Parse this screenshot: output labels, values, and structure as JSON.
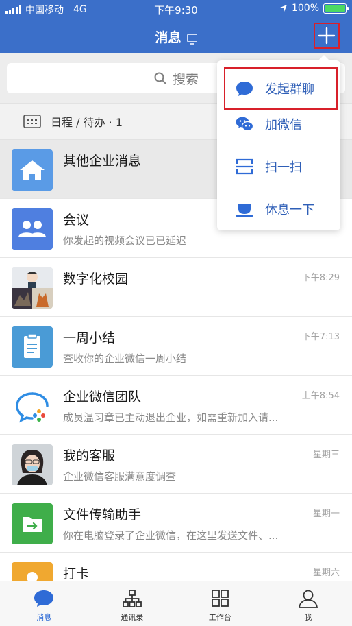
{
  "status_bar": {
    "carrier": "中国移动",
    "network": "4G",
    "time": "下午9:30",
    "battery": "100%"
  },
  "header": {
    "title": "消息"
  },
  "search": {
    "placeholder": "搜索"
  },
  "agenda": {
    "label": "日程 / 待办 · 1"
  },
  "popup_menu": {
    "items": [
      {
        "label": "发起群聊",
        "icon": "chat-bubble-icon"
      },
      {
        "label": "加微信",
        "icon": "wechat-icon"
      },
      {
        "label": "扫一扫",
        "icon": "scan-icon"
      },
      {
        "label": "休息一下",
        "icon": "rest-icon"
      }
    ]
  },
  "conversations": [
    {
      "title": "其他企业消息",
      "subtitle": "",
      "time": "",
      "icon": "building-icon",
      "color": "#5a9be6"
    },
    {
      "title": "会议",
      "subtitle": "你发起的视频会议已已延迟",
      "time": "",
      "icon": "meeting-icon",
      "color": "#4f7fe0"
    },
    {
      "title": "数字化校园",
      "subtitle": "",
      "time": "下午8:29",
      "icon": "group-photo-avatar",
      "color": "#bfbfbf"
    },
    {
      "title": "一周小结",
      "subtitle": "查收你的企业微信一周小结",
      "time": "下午7:13",
      "icon": "clipboard-icon",
      "color": "#4a9bd6"
    },
    {
      "title": "企业微信团队",
      "subtitle": "成员温习章已主动退出企业，如需重新加入请...",
      "time": "上午8:54",
      "icon": "wecom-logo-icon",
      "color": "#ffffff"
    },
    {
      "title": "我的客服",
      "subtitle": "企业微信客服满意度调查",
      "time": "星期三",
      "icon": "agent-photo-avatar",
      "color": "#c9c9c9"
    },
    {
      "title": "文件传输助手",
      "subtitle": "你在电脑登录了企业微信，在这里发送文件、...",
      "time": "星期一",
      "icon": "folder-icon",
      "color": "#3fae4a"
    },
    {
      "title": "打卡",
      "subtitle": "",
      "time": "星期六",
      "icon": "clock-in-icon",
      "color": "#f0a830"
    }
  ],
  "tabbar": {
    "items": [
      {
        "label": "消息",
        "active": true
      },
      {
        "label": "通讯录",
        "active": false
      },
      {
        "label": "工作台",
        "active": false
      },
      {
        "label": "我",
        "active": false
      }
    ]
  }
}
